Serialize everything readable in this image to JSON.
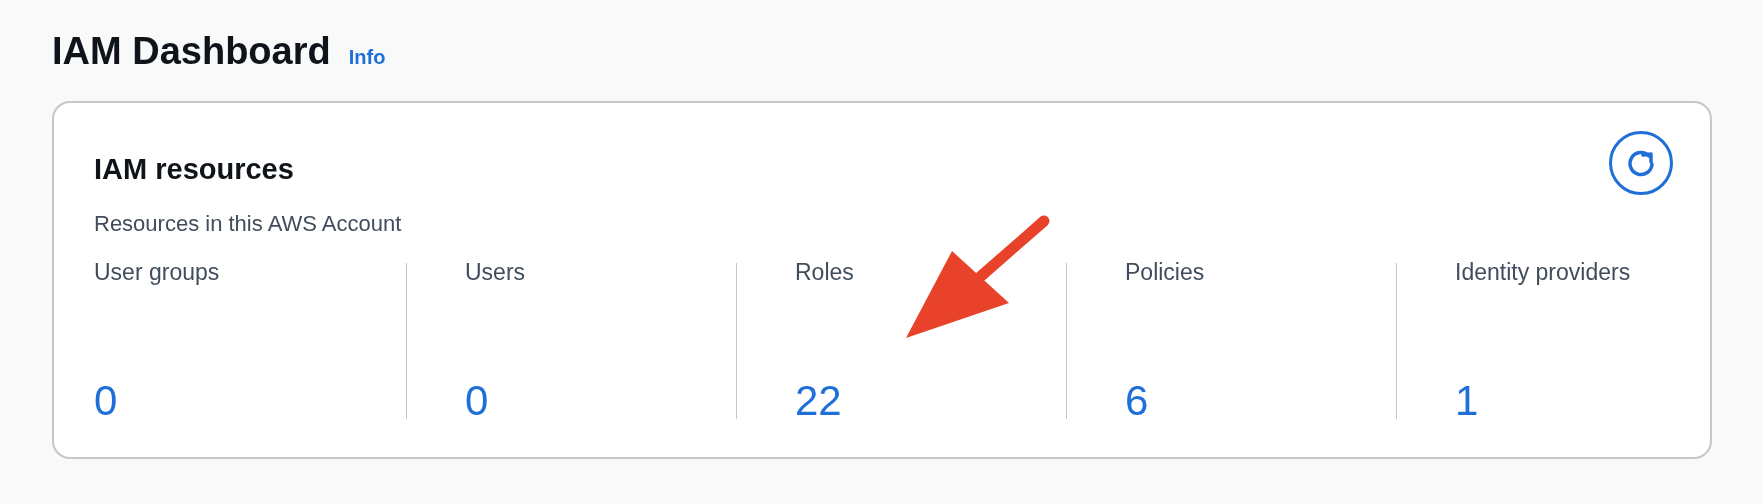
{
  "page": {
    "title": "IAM Dashboard",
    "info_link": "Info"
  },
  "card": {
    "title": "IAM resources",
    "subtitle": "Resources in this AWS Account",
    "resources": [
      {
        "label": "User groups",
        "count": "0"
      },
      {
        "label": "Users",
        "count": "0"
      },
      {
        "label": "Roles",
        "count": "22"
      },
      {
        "label": "Policies",
        "count": "6"
      },
      {
        "label": "Identity providers",
        "count": "1"
      }
    ]
  }
}
